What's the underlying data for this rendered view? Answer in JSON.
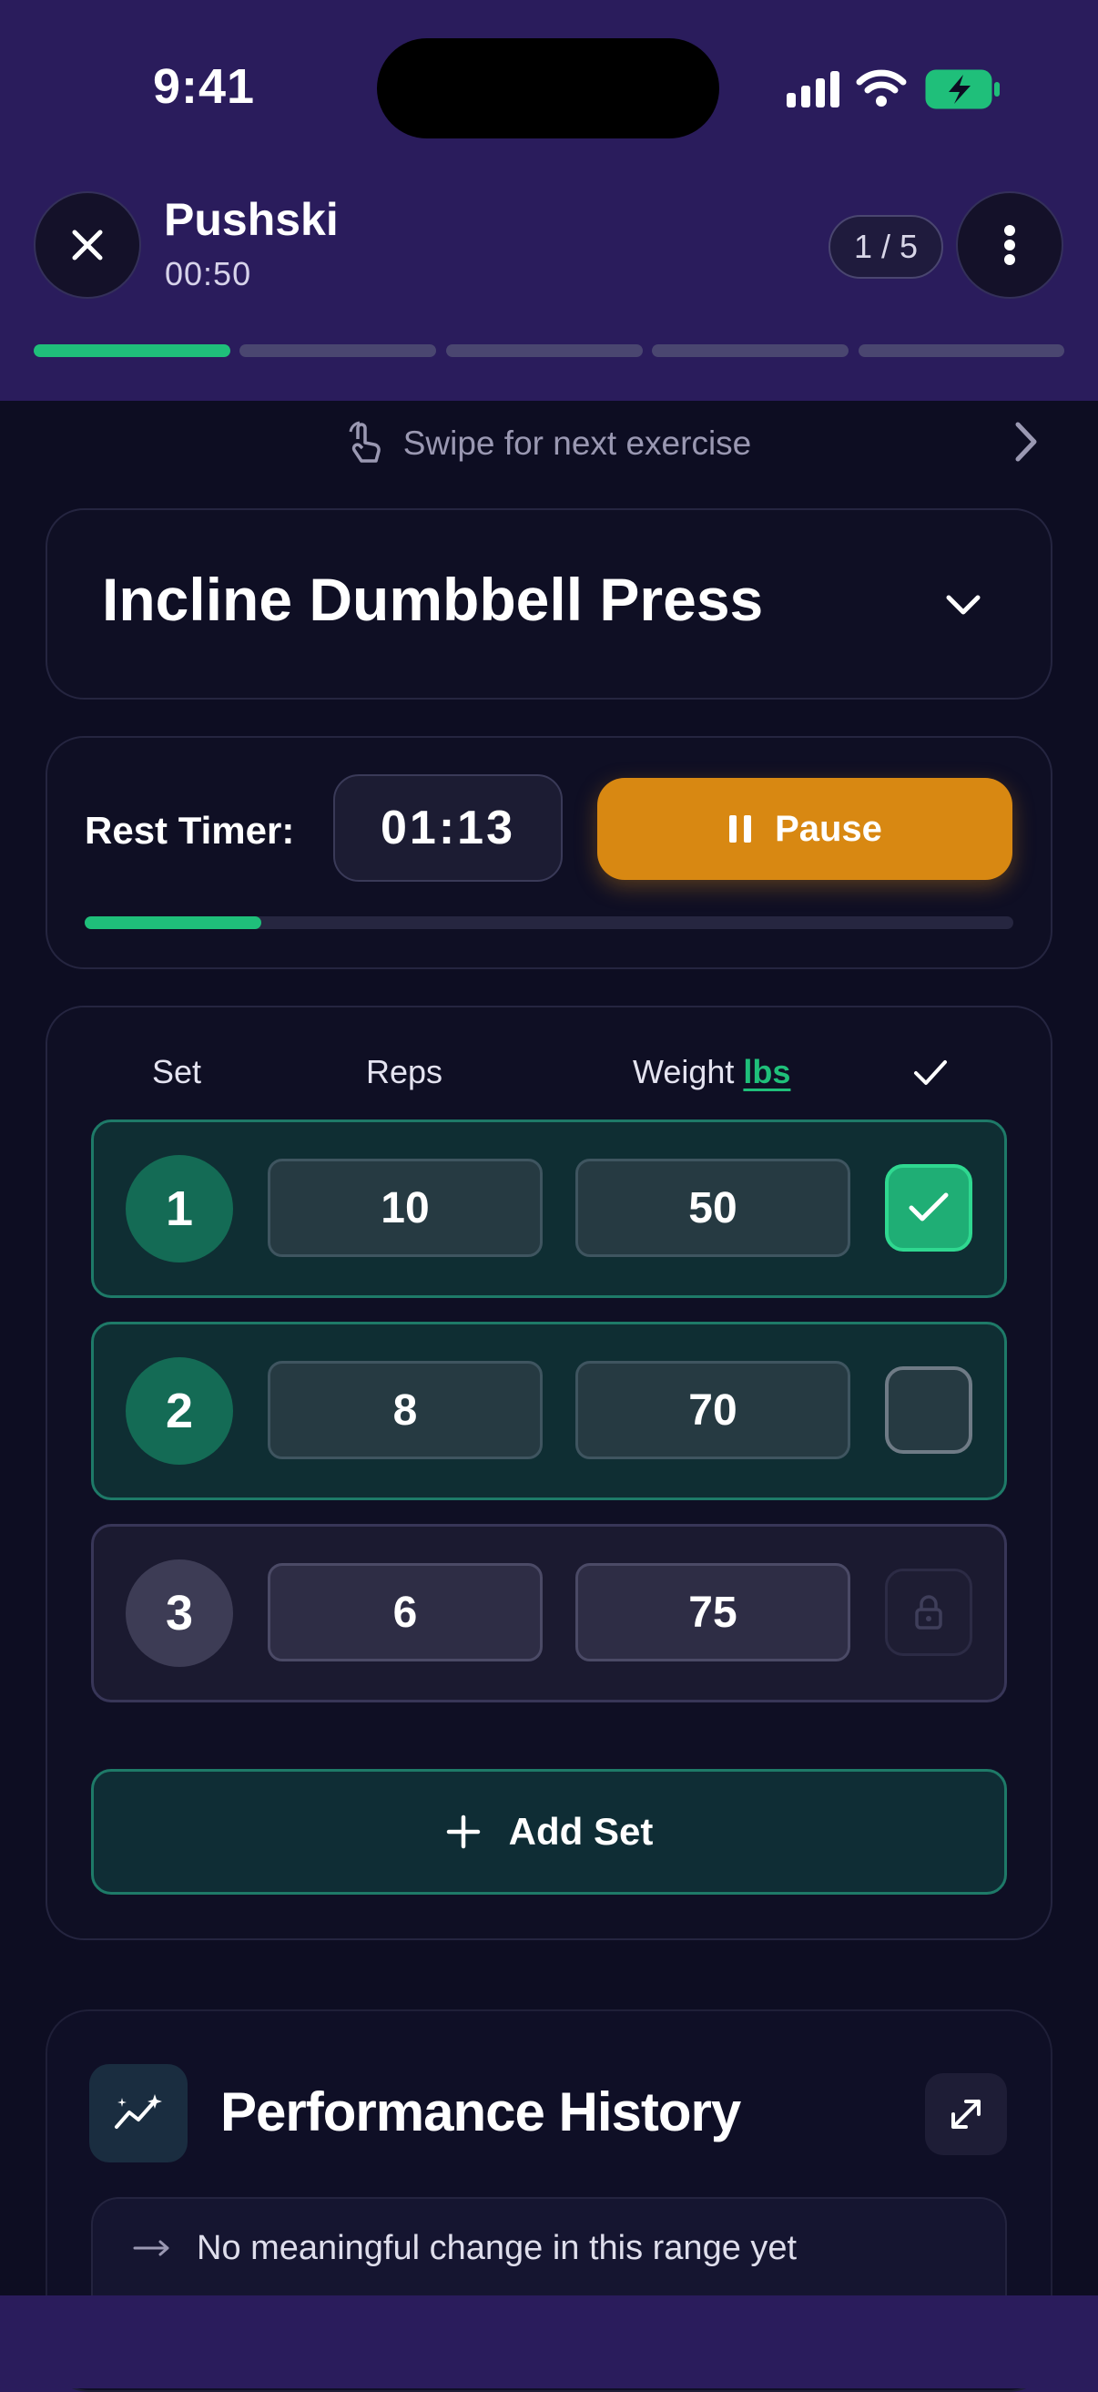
{
  "status_bar": {
    "time": "9:41"
  },
  "header": {
    "title": "Pushski",
    "elapsed": "00:50",
    "counter": "1 / 5",
    "progress_total": 5,
    "progress_done": 1
  },
  "swipe_hint": "Swipe for next exercise",
  "exercise": {
    "name": "Incline Dumbbell Press"
  },
  "rest": {
    "label": "Rest Timer:",
    "time": "01:13",
    "pause_label": "Pause",
    "progress_fraction": 0.19
  },
  "table": {
    "headers": {
      "set": "Set",
      "reps": "Reps",
      "weight": "Weight",
      "unit": "lbs"
    },
    "rows": [
      {
        "set": "1",
        "reps": "10",
        "weight": "50",
        "state": "completed"
      },
      {
        "set": "2",
        "reps": "8",
        "weight": "70",
        "state": "active"
      },
      {
        "set": "3",
        "reps": "6",
        "weight": "75",
        "state": "locked"
      }
    ],
    "add_label": "Add Set"
  },
  "performance": {
    "title": "Performance History",
    "note": "No meaningful change in this range yet"
  },
  "colors": {
    "accent_green": "#1fbf7a",
    "pause_orange": "#d88812",
    "header_bg": "#2a1c5c",
    "panel_bg": "#0d0d22"
  },
  "icons": [
    "close-icon",
    "more-vertical-icon",
    "swipe-hand-icon",
    "chevron-right-icon",
    "chevron-down-icon",
    "pause-icon",
    "check-icon",
    "lock-icon",
    "plus-icon",
    "sparkle-chart-icon",
    "expand-icon",
    "arrow-right-icon"
  ]
}
